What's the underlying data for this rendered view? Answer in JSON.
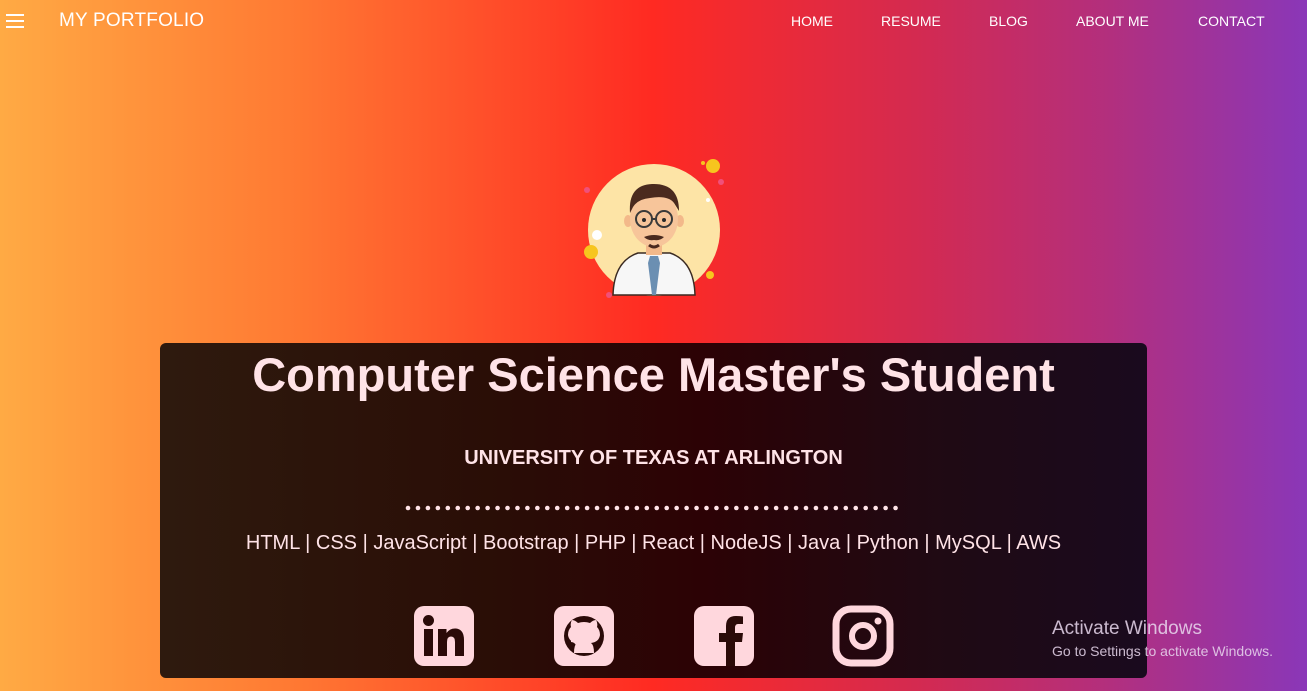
{
  "navbar": {
    "brand": "MY PORTFOLIO",
    "menu_icon": "hamburger-menu-icon",
    "links": [
      "HOME",
      "RESUME",
      "BLOG",
      "ABOUT ME",
      "CONTACT"
    ]
  },
  "hero": {
    "title": "Computer Science Master's Student",
    "university": "UNIVERSITY OF TEXAS AT ARLINGTON",
    "skills": "HTML | CSS | JavaScript | Bootstrap | PHP | React | NodeJS | Java | Python | MySQL | AWS",
    "social_icons": [
      "linkedin-icon",
      "github-icon",
      "facebook-icon",
      "instagram-icon"
    ]
  },
  "watermark": {
    "title": "Activate Windows",
    "subtitle": "Go to Settings to activate Windows."
  },
  "colors": {
    "text_light": "#ffe3e7",
    "gradient": [
      "#ffaa44",
      "#ff2a22",
      "#8a37b8"
    ]
  }
}
